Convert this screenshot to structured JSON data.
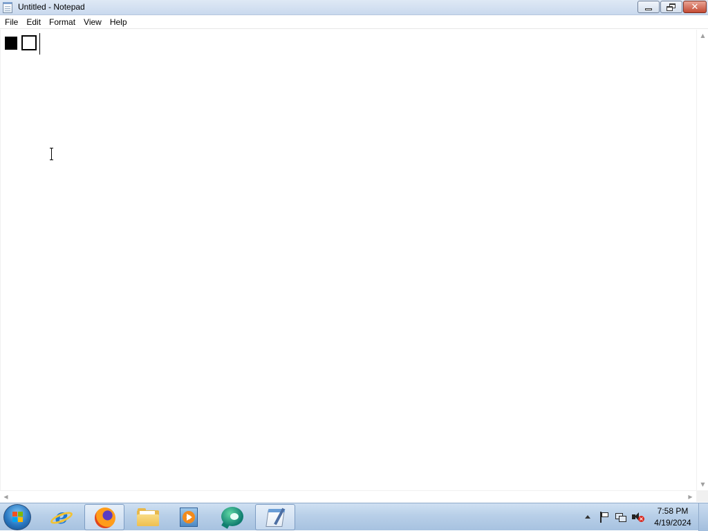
{
  "window": {
    "title": "Untitled - Notepad",
    "icon": "notepad-icon"
  },
  "menu": {
    "items": [
      "File",
      "Edit",
      "Format",
      "View",
      "Help"
    ]
  },
  "editor": {
    "content_glyphs": [
      "black-square",
      "white-square"
    ]
  },
  "taskbar": {
    "pinned": [
      {
        "name": "internet-explorer",
        "icon": "ie-icon",
        "active": false
      },
      {
        "name": "firefox",
        "icon": "firefox-icon",
        "active": true
      },
      {
        "name": "file-explorer",
        "icon": "folder-icon",
        "active": false
      },
      {
        "name": "media-player",
        "icon": "media-player-icon",
        "active": false
      },
      {
        "name": "chat-app",
        "icon": "chat-icon",
        "active": false
      },
      {
        "name": "notepad",
        "icon": "notepad-icon",
        "active": true
      }
    ],
    "tray_icons": [
      "show-hidden-icons",
      "action-center-flag-icon",
      "network-icon",
      "volume-muted-icon"
    ],
    "clock": {
      "time": "7:58 PM",
      "date": "4/19/2024"
    }
  }
}
